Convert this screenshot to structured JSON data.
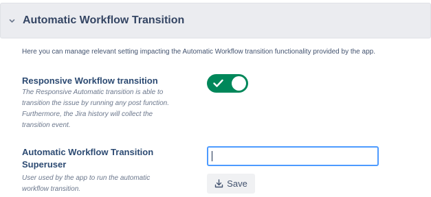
{
  "header": {
    "title": "Automatic Workflow Transition",
    "collapse_icon": "chevron-down-icon"
  },
  "intro_text": "Here you can manage relevant setting impacting the Automatic Workflow transition functionality provided by the app.",
  "settings": [
    {
      "title": "Responsive Workflow transition",
      "description_lines": [
        "The Responsive Automatic transition is able to",
        "transition the issue by running any post function.",
        "Furthermore, the Jira history will collect the",
        "transition event."
      ],
      "control": "toggle",
      "enabled": true
    },
    {
      "title_lines": [
        "Automatic Workflow Transition",
        "Superuser"
      ],
      "description_lines": [
        "User used by the app to run the automatic",
        "workflow transition."
      ],
      "control": "text",
      "value": "",
      "placeholder": ""
    }
  ],
  "save_button": {
    "label": "Save",
    "icon": "download-icon"
  },
  "colors": {
    "accent": "#00875a",
    "title": "#2c4a72",
    "focus_border": "#4c9aff",
    "header_bg": "#ebecf0"
  }
}
